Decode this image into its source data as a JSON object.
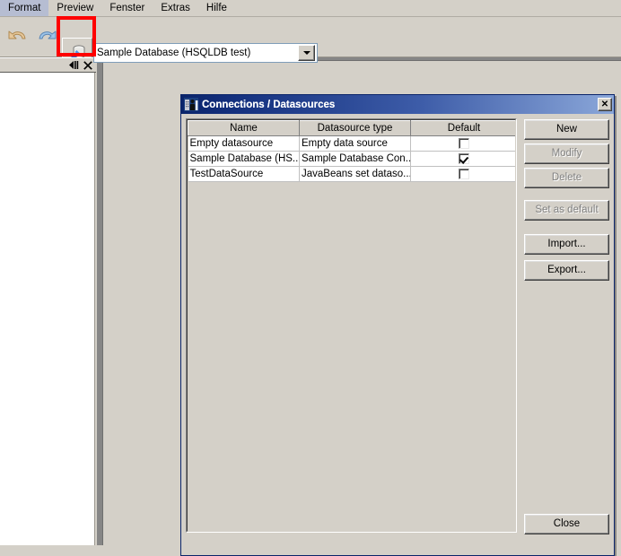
{
  "menubar": {
    "items": [
      {
        "label": "Format"
      },
      {
        "label": "Preview"
      },
      {
        "label": "Fenster"
      },
      {
        "label": "Extras"
      },
      {
        "label": "Hilfe"
      }
    ]
  },
  "toolbar": {
    "undo_icon": "undo-arrow-icon",
    "redo_icon": "redo-arrow-icon",
    "datasource_button_icon": "database-connection-icon",
    "combo": {
      "value": "Sample Database (HSQLDB test)",
      "arrow_icon": "chevron-down-icon"
    },
    "highlight_color": "#ff0000"
  },
  "left_dock": {
    "minimize_icon": "minimize-dock-icon",
    "close_icon": "close-icon"
  },
  "dialog": {
    "title": "Connections / Datasources",
    "icon": "connections-datasources-icon",
    "close_label": "✕",
    "titlebar_color_start": "#0a246a",
    "titlebar_color_end": "#8ba7d9",
    "table": {
      "columns": [
        "Name",
        "Datasource type",
        "Default"
      ],
      "rows": [
        {
          "name": "Empty datasource",
          "type": "Empty data source",
          "default": false
        },
        {
          "name": "Sample Database (HS...",
          "type": "Sample Database Con...",
          "default": true
        },
        {
          "name": "TestDataSource",
          "type": "JavaBeans set dataso...",
          "default": false
        }
      ]
    },
    "buttons": [
      {
        "label": "New",
        "enabled": true
      },
      {
        "label": "Modify",
        "enabled": false
      },
      {
        "label": "Delete",
        "enabled": false
      },
      {
        "label": "Set as default",
        "enabled": false
      },
      {
        "label": "Import...",
        "enabled": true
      },
      {
        "label": "Export...",
        "enabled": true
      }
    ],
    "close_button_label": "Close"
  }
}
